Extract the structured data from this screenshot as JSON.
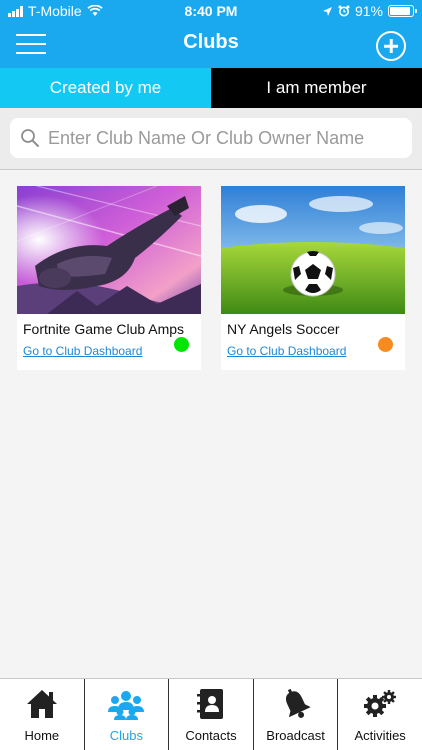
{
  "status": {
    "carrier": "T-Mobile",
    "time": "8:40 PM",
    "battery": "91%",
    "battery_level": 0.91
  },
  "header": {
    "title": "Clubs",
    "menu_icon": "hamburger-menu-icon",
    "add_icon": "plus-circle-icon"
  },
  "tabs": [
    {
      "label": "Created by me",
      "active": true
    },
    {
      "label": "I am member",
      "active": false
    }
  ],
  "search": {
    "placeholder": "Enter Club Name Or Club Owner Name",
    "value": ""
  },
  "clubs": [
    {
      "name": "Fortnite Game Club Amps",
      "link": "Go to Club Dashboard",
      "status_color": "#00e600"
    },
    {
      "name": "NY Angels Soccer",
      "link": "Go to Club Dashboard",
      "status_color": "#f68b1f"
    }
  ],
  "nav": [
    {
      "label": "Home",
      "icon": "home-icon",
      "active": false
    },
    {
      "label": "Clubs",
      "icon": "group-icon",
      "active": true
    },
    {
      "label": "Contacts",
      "icon": "contacts-book-icon",
      "active": false
    },
    {
      "label": "Broadcast",
      "icon": "bell-icon",
      "active": false
    },
    {
      "label": "Activities",
      "icon": "gears-icon",
      "active": false
    }
  ],
  "colors": {
    "header": "#1aa9ee",
    "tab_active": "#13c9f4",
    "tab_inactive": "#000000",
    "link": "#1f88d6"
  }
}
